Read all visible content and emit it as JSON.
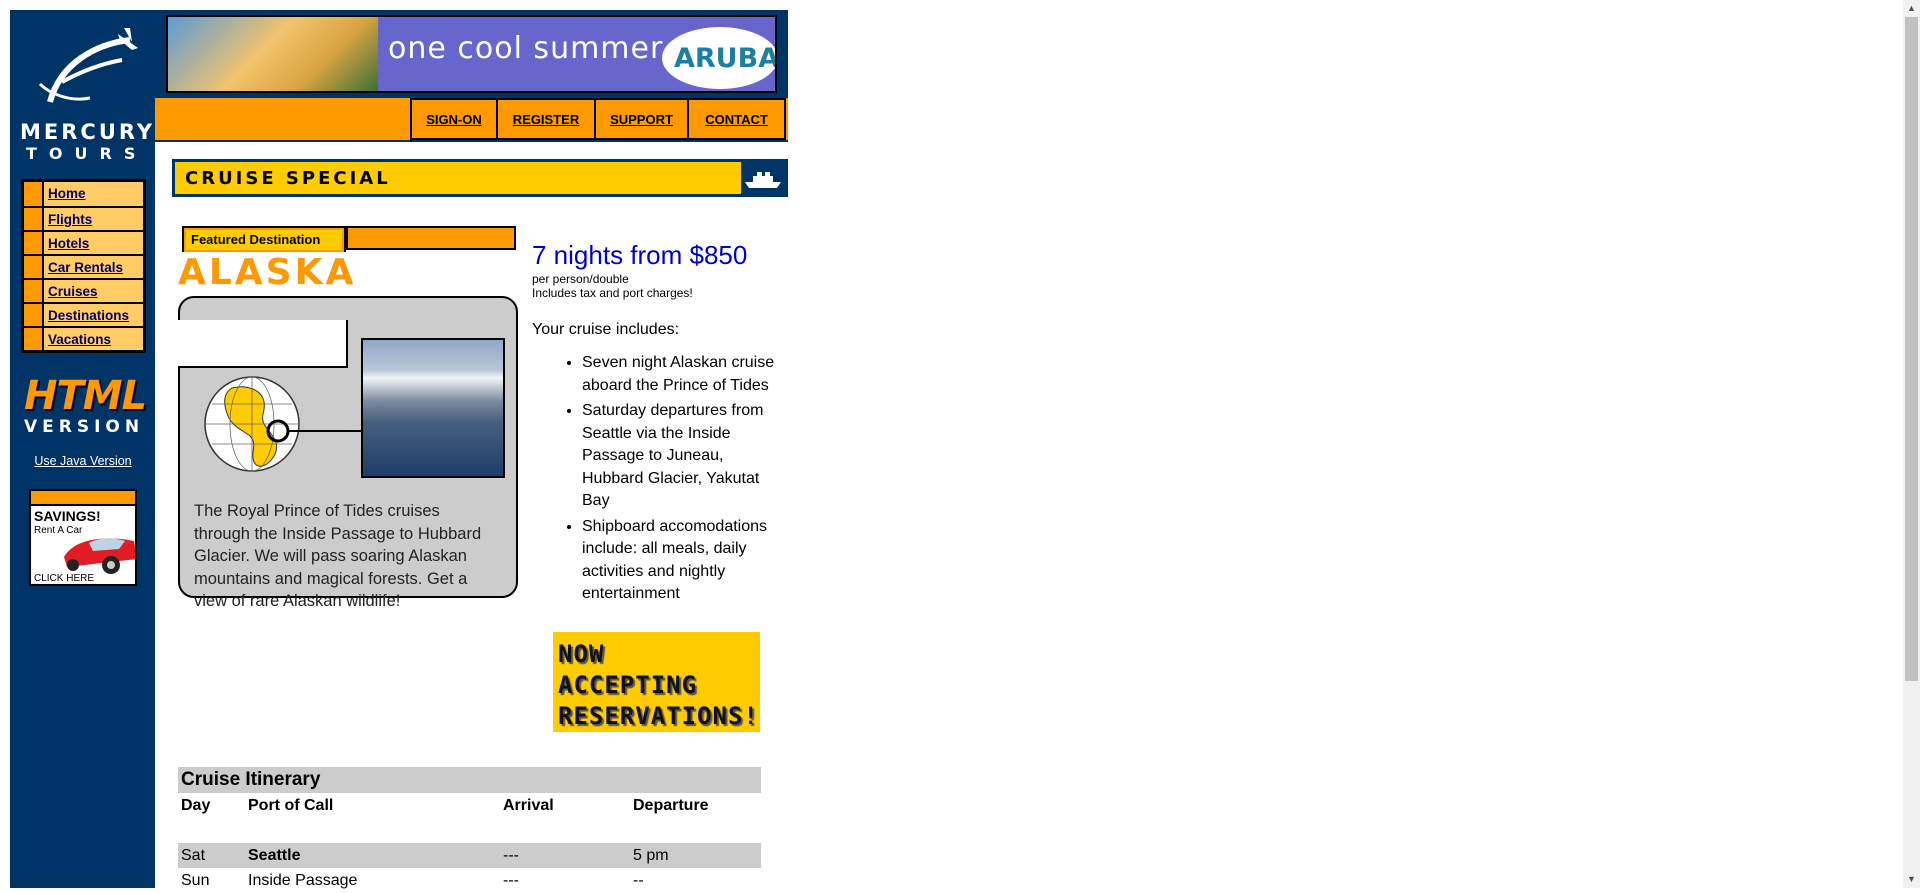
{
  "brand": {
    "name": "MERCURY",
    "sub": "TOURS"
  },
  "left_nav": {
    "items": [
      {
        "label": "Home"
      },
      {
        "label": "Flights"
      },
      {
        "label": "Hotels"
      },
      {
        "label": "Car Rentals"
      },
      {
        "label": "Cruises"
      },
      {
        "label": "Destinations"
      },
      {
        "label": "Vacations"
      }
    ],
    "html_version": {
      "big": "HTML",
      "sub": "VERSION"
    },
    "java_link": "Use Java Version",
    "savings_ad": {
      "title": "SAVINGS!",
      "sub": "Rent A Car",
      "cta": "CLICK HERE"
    }
  },
  "banner": {
    "text": "one cool summer",
    "brand": "ARUBA"
  },
  "top_menu": {
    "items": [
      {
        "label": "SIGN-ON"
      },
      {
        "label": "REGISTER"
      },
      {
        "label": "SUPPORT"
      },
      {
        "label": "CONTACT"
      }
    ]
  },
  "section": {
    "title": "CRUISE SPECIAL"
  },
  "featured": {
    "tab_label": "Featured Destination",
    "destination": "ALASKA",
    "description": "The Royal Prince of Tides cruises through the Inside Passage to Hubbard Glacier. We will pass soaring Alaskan mountains and magical forests. Get a view of rare Alaskan wildlife!"
  },
  "offer": {
    "price_headline": "7 nights from $850",
    "per_person": "per person/double",
    "tax_note": "Includes tax and port charges!",
    "includes_label": "Your cruise includes:",
    "includes": [
      "Seven night Alaskan cruise aboard the Prince of Tides",
      "Saturday departures from Seattle via the Inside Passage to Juneau, Hubbard Glacier, Yakutat Bay",
      "Shipboard accomodations include: all meals, daily activities and nightly entertainment"
    ],
    "reservations": [
      "NOW",
      "ACCEPTING",
      "RESERVATIONS!"
    ]
  },
  "itinerary": {
    "title": "Cruise Itinerary",
    "columns": [
      "Day",
      "Port of Call",
      "Arrival",
      "Departure"
    ],
    "rows": [
      {
        "day": "Sat",
        "port": "Seattle",
        "arrival": "---",
        "departure": "5 pm"
      },
      {
        "day": "Sun",
        "port": "Inside Passage",
        "arrival": "---",
        "departure": "--"
      }
    ]
  },
  "colors": {
    "navy": "#003366",
    "orange": "#ff9900",
    "yellow": "#ffcc00",
    "light_orange": "#ffcc66",
    "price_blue": "#0000cc"
  }
}
